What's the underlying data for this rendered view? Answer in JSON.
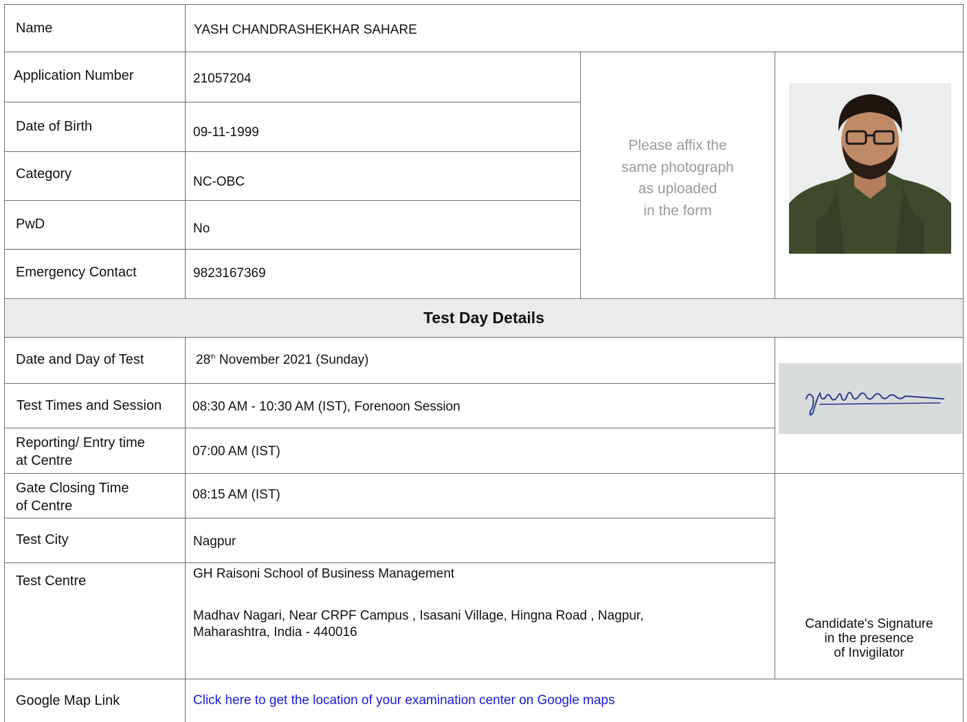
{
  "candidate": {
    "name_label": "Name",
    "name_value": "YASH CHANDRASHEKHAR SAHARE",
    "application_number_label": "Application Number",
    "application_number_value": "21057204",
    "dob_label": "Date of Birth",
    "dob_value": "09-11-1999",
    "category_label": "Category",
    "category_value": "NC-OBC",
    "pwd_label": "PwD",
    "pwd_value": "No",
    "emergency_label": "Emergency Contact",
    "emergency_value": "9823167369"
  },
  "photo_box": {
    "line1": "Please affix the",
    "line2": "same photograph",
    "line3": "as uploaded",
    "line4": "in the form"
  },
  "test_day": {
    "heading": "Test Day Details",
    "date_label": "Date and Day of Test",
    "date_day": "28",
    "date_suffix": "th",
    "date_rest": " November 2021 (Sunday)",
    "times_label": "Test Times and Session",
    "times_value": "08:30 AM - 10:30 AM (IST), Forenoon Session",
    "reporting_label_1": "Reporting/ Entry time",
    "reporting_label_2": "at Centre",
    "reporting_value": "07:00 AM (IST)",
    "gate_label_1": "Gate Closing Time",
    "gate_label_2": "of Centre",
    "gate_value": "08:15 AM (IST)",
    "city_label": "Test City",
    "city_value": "Nagpur",
    "centre_label": "Test Centre",
    "centre_name": "GH Raisoni School of Business Management",
    "centre_address_1": "Madhav Nagari,  Near CRPF Campus ,  Isasani Village,  Hingna Road , Nagpur,",
    "centre_address_2": "Maharashtra, India - 440016",
    "map_label": "Google Map Link",
    "map_link_text": "Click here to get the location of your examination center on Google maps"
  },
  "signature_box": {
    "line1": "Candidate's Signature",
    "line2": "in the presence",
    "line3": "of Invigilator",
    "signature_text": "yashsahare"
  },
  "colors": {
    "border": "#6e6e6e",
    "header_bg": "#ebebeb",
    "link": "#1a1ad6",
    "hint_text": "#9a9a9a"
  }
}
